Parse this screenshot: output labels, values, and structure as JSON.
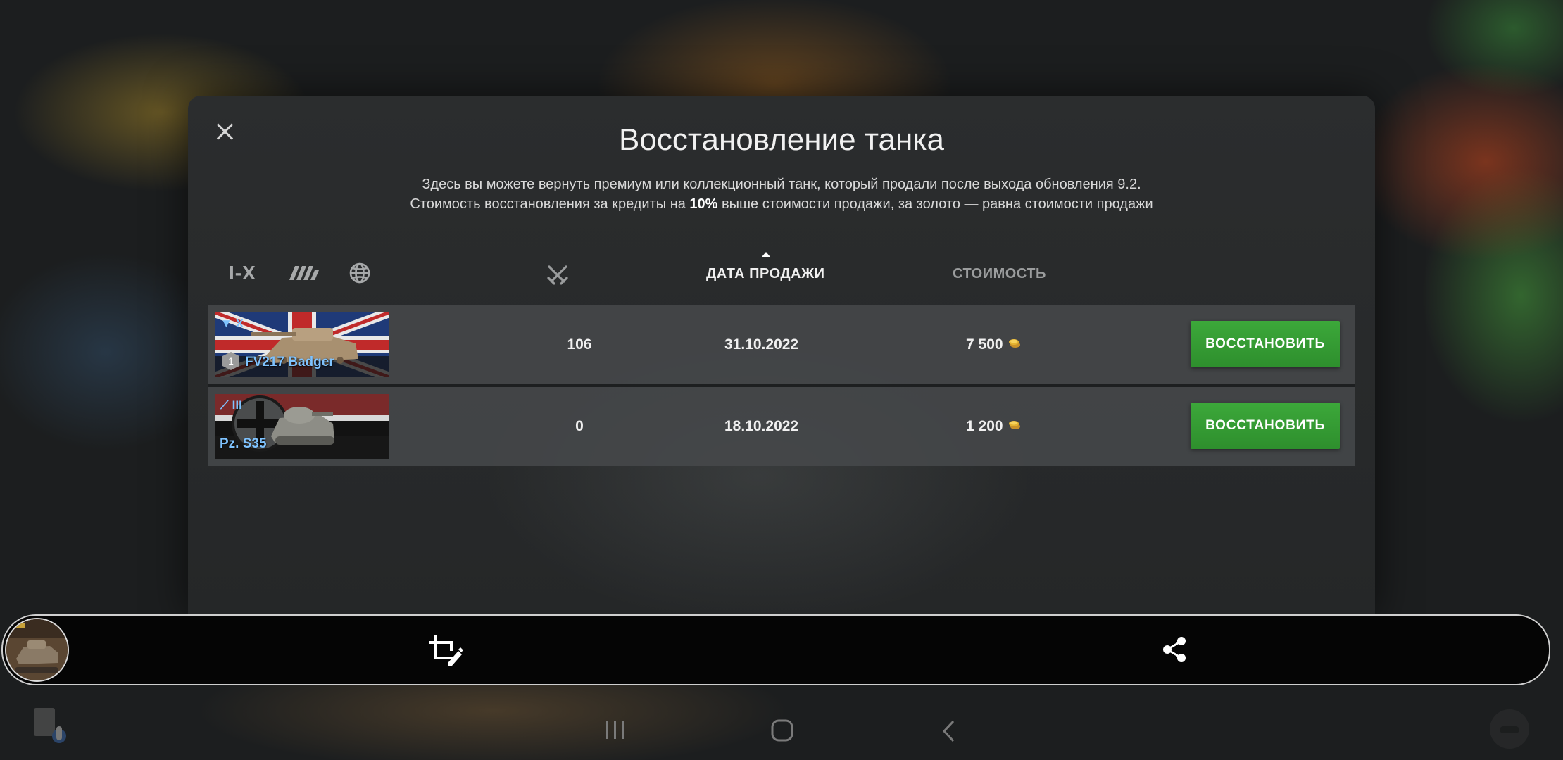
{
  "dialog": {
    "title": "Восстановление танка",
    "description_line1": "Здесь вы можете вернуть премиум или коллекционный танк, который продали после выхода обновления 9.2.",
    "description_line2_before": "Стоимость восстановления за кредиты на ",
    "description_line2_bold": "10%",
    "description_line2_after": " выше стоимости продажи, за золото — равна стоимости продажи",
    "close_icon": "close-icon"
  },
  "filters": {
    "tier_label": "I-X",
    "type_icon": "vehicle-type-icon",
    "nation_icon": "globe-icon"
  },
  "columns": {
    "battles_icon": "crossed-swords-icon",
    "sale_date": "ДАТА ПРОДАЖИ",
    "cost": "СТОИМОСТЬ"
  },
  "tanks": [
    {
      "tier": "X",
      "name": "FV217 Badger",
      "badge": "1",
      "battles": "106",
      "date": "31.10.2022",
      "cost": "7 500",
      "currency_icon": "gold-coins-icon",
      "button": "ВОССТАНОВИТЬ"
    },
    {
      "tier": "III",
      "name": "Pz. S35",
      "battles": "0",
      "date": "18.10.2022",
      "cost": "1 200",
      "currency_icon": "gold-coins-icon",
      "button": "ВОССТАНОВИТЬ"
    }
  ],
  "screenshot_bar": {
    "crop_icon": "crop-edit-icon",
    "share_icon": "share-icon"
  },
  "system_nav": {
    "recents_icon": "recents-icon",
    "home_icon": "home-icon",
    "back_icon": "back-icon"
  },
  "colors": {
    "accent_green": "#36a036",
    "tank_name_blue": "#7fc3ff",
    "gold": "#e5b431"
  }
}
